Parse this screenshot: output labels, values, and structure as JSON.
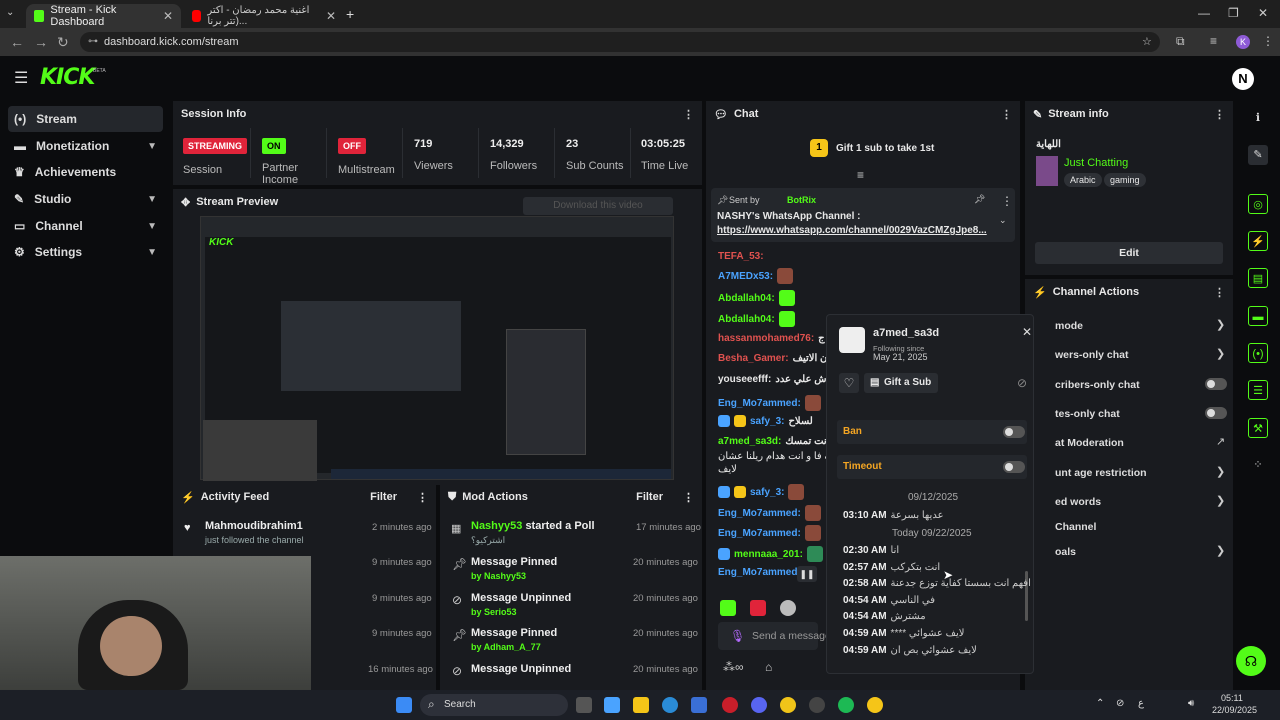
{
  "browser": {
    "tabs": [
      {
        "title": "Stream - Kick Dashboard",
        "active": true
      },
      {
        "title": "اغنية محمد رمضان - اكتر (تتر برنا...",
        "active": false
      }
    ],
    "url": "dashboard.kick.com/stream",
    "profile_initial": "K"
  },
  "header": {
    "logo": "KICK",
    "beta": "BETA",
    "avatar_initial": "N"
  },
  "sidebar": {
    "items": [
      {
        "label": "Stream",
        "icon": "broadcast-icon",
        "active": true,
        "chevron": false
      },
      {
        "label": "Monetization",
        "icon": "money-icon",
        "chevron": true
      },
      {
        "label": "Achievements",
        "icon": "trophy-icon",
        "chevron": false
      },
      {
        "label": "Studio",
        "icon": "studio-icon",
        "chevron": true
      },
      {
        "label": "Channel",
        "icon": "channel-icon",
        "chevron": true
      },
      {
        "label": "Settings",
        "icon": "gear-icon",
        "chevron": true
      }
    ]
  },
  "session_info": {
    "title": "Session Info",
    "session": {
      "badge": "STREAMING",
      "label": "Session"
    },
    "partner": {
      "badge": "ON",
      "label": "Partner Income"
    },
    "multistream": {
      "badge": "OFF",
      "label": "Multistream"
    },
    "viewers": {
      "value": "719",
      "label": "Viewers"
    },
    "followers": {
      "value": "14,329",
      "label": "Followers"
    },
    "subs": {
      "value": "23",
      "label": "Sub Counts"
    },
    "time_live": {
      "value": "03:05:25",
      "label": "Time Live"
    }
  },
  "stream_preview": {
    "title": "Stream Preview",
    "download_label": "Download this video"
  },
  "activity_feed": {
    "title": "Activity Feed",
    "filter": "Filter",
    "items": [
      {
        "name": "Mahmoudibrahim1",
        "sub": "just followed the channel",
        "time": "2 minutes ago"
      },
      {
        "name": "",
        "sub": "",
        "time": "9 minutes ago"
      },
      {
        "name": "",
        "sub": "",
        "time": "9 minutes ago"
      },
      {
        "name": "",
        "sub": "",
        "time": "9 minutes ago"
      },
      {
        "name": "",
        "sub": "",
        "time": "16 minutes ago"
      }
    ]
  },
  "mod_actions": {
    "title": "Mod Actions",
    "filter": "Filter",
    "items": [
      {
        "title_user": "Nashyy53",
        "title_rest": "started a Poll",
        "sub": "اشتركيو؟",
        "time": "17 minutes ago"
      },
      {
        "title_user": "",
        "title_rest": "Message Pinned",
        "sub": "by Nashyy53",
        "time": "20 minutes ago"
      },
      {
        "title_user": "",
        "title_rest": "Message Unpinned",
        "sub": "by Serio53",
        "time": "20 minutes ago"
      },
      {
        "title_user": "",
        "title_rest": "Message Pinned",
        "sub": "by Adham_A_77",
        "time": "20 minutes ago"
      },
      {
        "title_user": "",
        "title_rest": "Message Unpinned",
        "sub": "",
        "time": "20 minutes ago"
      }
    ]
  },
  "chat": {
    "title": "Chat",
    "gift_banner": "Gift 1 sub to take 1st",
    "gift_count": "1",
    "pinned": {
      "sent_by_label": "Sent by",
      "sender": "BotRix",
      "text": "NASHY's WhatsApp Channel :",
      "link": "https://www.whatsapp.com/channel/0029VazCMZgJpe8..."
    },
    "messages": [
      {
        "user": "TEFA_53:",
        "color": "#e0524f",
        "text": ""
      },
      {
        "user": "A7MEDx53:",
        "color": "#4aa3ff",
        "text": ""
      },
      {
        "user": "Abdallah04:",
        "color": "#53fc18",
        "text": ""
      },
      {
        "user": "Abdallah04:",
        "color": "#53fc18",
        "text": ""
      },
      {
        "user": "hassanmohamed76:",
        "color": "#e0524f",
        "text": "ج"
      },
      {
        "user": "Besha_Gamer:",
        "color": "#e0524f",
        "text": "ن الاتيف"
      },
      {
        "user": "youseeefff:",
        "color": "#dddddd",
        "text": "صدش علي عدد"
      },
      {
        "user": "Eng_Mo7ammed:",
        "color": "#4aa3ff",
        "text": ""
      },
      {
        "user": "safy_3:",
        "color": "#4aa3ff",
        "text": "لسلاح"
      },
      {
        "user": "a7med_sa3d:",
        "color": "#53fc18",
        "text": "ي انت تمسك"
      },
      {
        "user": "",
        "color": "#dddddd",
        "text": "اني اقف فا و انت هدام ريلنا عشان"
      },
      {
        "user": "",
        "color": "#dddddd",
        "text": "لايف"
      },
      {
        "user": "safy_3:",
        "color": "#4aa3ff",
        "text": ""
      },
      {
        "user": "Eng_Mo7ammed:",
        "color": "#4aa3ff",
        "text": ""
      },
      {
        "user": "Eng_Mo7ammed:",
        "color": "#4aa3ff",
        "text": ""
      },
      {
        "user": "mennaaa_201:",
        "color": "#53fc18",
        "text": ""
      },
      {
        "user": "Eng_Mo7ammed:",
        "color": "#4aa3ff",
        "text": ""
      }
    ],
    "input_placeholder": "Send a message"
  },
  "user_popup": {
    "username": "a7med_sa3d",
    "following_label": "Following since",
    "following_date": "May 21, 2025",
    "gift_sub": "Gift a Sub",
    "ban": "Ban",
    "timeout": "Timeout",
    "log": [
      {
        "type": "date",
        "text": "09/12/2025"
      },
      {
        "type": "msg",
        "time": "03:10 AM",
        "text": "عديها بسرعة"
      },
      {
        "type": "date",
        "text": "Today 09/22/2025"
      },
      {
        "type": "msg",
        "time": "02:30 AM",
        "text": "انا"
      },
      {
        "type": "msg",
        "time": "02:57 AM",
        "text": "انت بتكركب"
      },
      {
        "type": "msg",
        "time": "02:58 AM",
        "text": "افهم انت بسستا كفاية توزع جدعنة"
      },
      {
        "type": "msg",
        "time": "04:54 AM",
        "text": "في الناسي"
      },
      {
        "type": "msg",
        "time": "04:54 AM",
        "text": "مشترش"
      },
      {
        "type": "msg",
        "time": "04:59 AM",
        "text": "**** لايف عشوائي"
      },
      {
        "type": "msg",
        "time": "04:59 AM",
        "text": "لايف عشوائي بص ان"
      }
    ]
  },
  "stream_info": {
    "title": "Stream info",
    "stream_title": "اللهاية",
    "category": "Just Chatting",
    "tags": [
      "Arabic",
      "gaming"
    ],
    "edit": "Edit"
  },
  "channel_actions": {
    "title": "Channel Actions",
    "items": [
      {
        "label": "mode",
        "control": "arrow"
      },
      {
        "label": "wers-only chat",
        "control": "arrow"
      },
      {
        "label": "cribers-only chat",
        "control": "toggle"
      },
      {
        "label": "tes-only chat",
        "control": "toggle"
      },
      {
        "label": "at Moderation",
        "control": "external"
      },
      {
        "label": "unt age restriction",
        "control": "arrow"
      },
      {
        "label": "ed words",
        "control": "arrow"
      },
      {
        "label": "Channel",
        "control": "none"
      },
      {
        "label": "oals",
        "control": "arrow"
      }
    ]
  },
  "taskbar": {
    "search": "Search",
    "clock_time": "05:11",
    "clock_date": "22/09/2025",
    "lang": "ع"
  },
  "colors": {
    "accent": "#53fc18",
    "live_red": "#e0243a",
    "panel": "#191b1f",
    "bg": "#0b0c0e"
  }
}
